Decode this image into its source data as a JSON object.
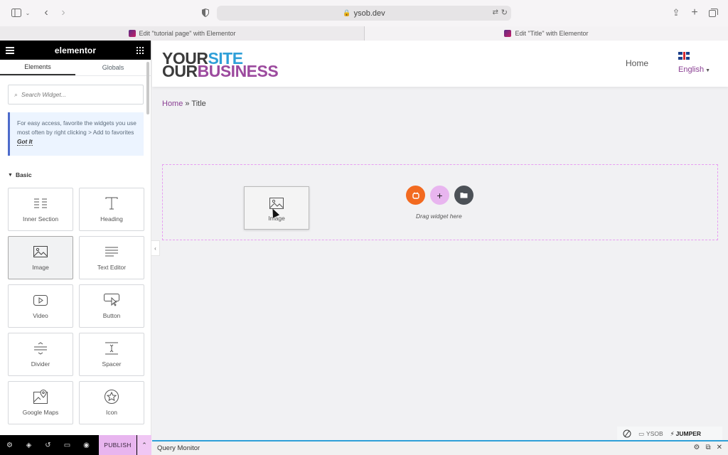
{
  "browser": {
    "url": "ysob.dev",
    "tabs": [
      {
        "label": "Edit \"tutorial page\" with Elementor"
      },
      {
        "label": "Edit \"Title\" with Elementor"
      }
    ]
  },
  "sidebar": {
    "logo": "elementor",
    "tabs": [
      "Elements",
      "Globals"
    ],
    "search_placeholder": "Search Widget...",
    "tip": "For easy access, favorite the widgets you use most often by right clicking > Add to favorites",
    "tip_link": "Got It",
    "section": "Basic",
    "widgets": [
      {
        "label": "Inner Section",
        "icon": "columns-icon"
      },
      {
        "label": "Heading",
        "icon": "heading-icon"
      },
      {
        "label": "Image",
        "icon": "image-icon"
      },
      {
        "label": "Text Editor",
        "icon": "text-editor-icon"
      },
      {
        "label": "Video",
        "icon": "video-icon"
      },
      {
        "label": "Button",
        "icon": "button-icon"
      },
      {
        "label": "Divider",
        "icon": "divider-icon"
      },
      {
        "label": "Spacer",
        "icon": "spacer-icon"
      },
      {
        "label": "Google Maps",
        "icon": "map-icon"
      },
      {
        "label": "Icon",
        "icon": "star-icon"
      }
    ],
    "publish": "PUBLISH"
  },
  "site": {
    "logo_line1_a": "YOUR",
    "logo_line1_b": "SITE",
    "logo_line2_a": "OUR",
    "logo_line2_b": "BUSINESS",
    "nav_home": "Home",
    "language": "English"
  },
  "breadcrumb": {
    "home": "Home",
    "sep": "»",
    "current": "Title"
  },
  "dropzone": {
    "text": "Drag widget here"
  },
  "drag_ghost": {
    "label": "Image"
  },
  "badge": {
    "ysob": "YSOB",
    "jumper": "JUMPER"
  },
  "query_monitor": "Query Monitor",
  "colors": {
    "accent": "#e8b5ef",
    "orange": "#f26a20",
    "purple": "#9c4a9e",
    "blue": "#2f9fd8"
  }
}
